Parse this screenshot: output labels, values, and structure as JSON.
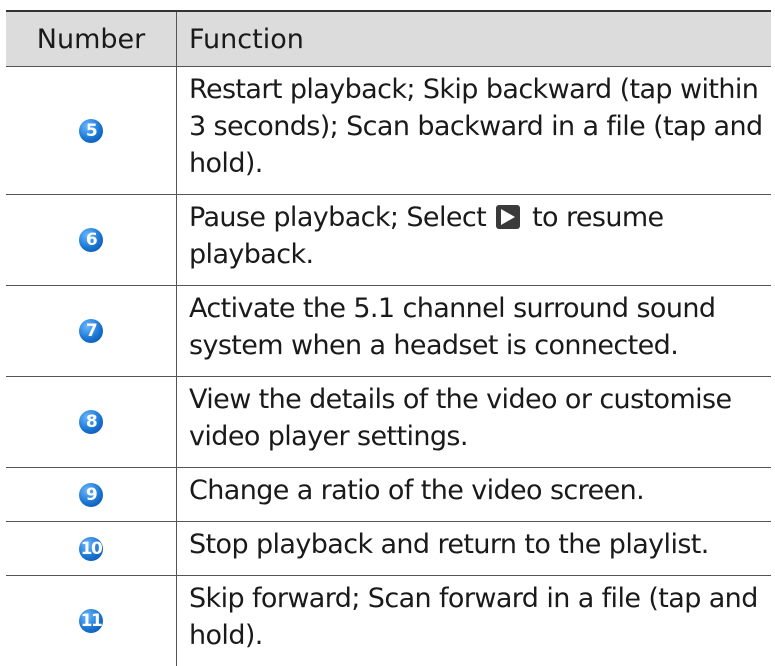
{
  "table": {
    "header": {
      "number": "Number",
      "function": "Function"
    },
    "rows": [
      {
        "number": "5",
        "function": "Restart playback; Skip backward (tap within 3 seconds); Scan backward in a file (tap and hold)."
      },
      {
        "number": "6",
        "function_before": "Pause playback; Select",
        "function_after": "to resume playback.",
        "icon": "play-icon"
      },
      {
        "number": "7",
        "function": "Activate the 5.1 channel surround sound system when a headset is connected."
      },
      {
        "number": "8",
        "function": "View the details of the video or customise video player settings."
      },
      {
        "number": "9",
        "function": "Change a ratio of the video screen."
      },
      {
        "number": "10",
        "function": "Stop playback and return to the playlist."
      },
      {
        "number": "11",
        "function": "Skip forward; Scan forward in a file (tap and hold)."
      }
    ]
  },
  "colors": {
    "header_bg": "#dcdcdc",
    "badge": "#1976d2",
    "border": "#555555"
  }
}
